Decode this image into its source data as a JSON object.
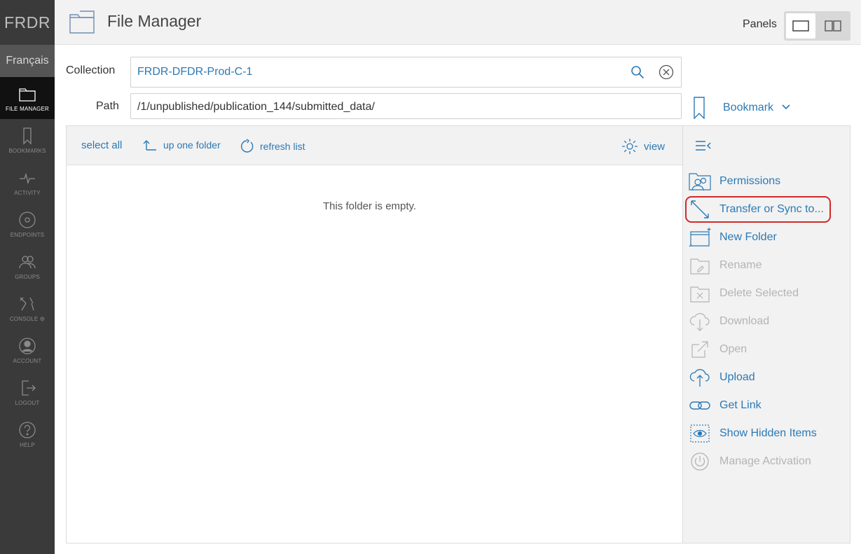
{
  "brand": "FRDR",
  "language": "Français",
  "nav": [
    {
      "label": "FILE MANAGER",
      "icon": "folder-icon",
      "active": true
    },
    {
      "label": "BOOKMARKS",
      "icon": "bookmark-icon",
      "active": false
    },
    {
      "label": "ACTIVITY",
      "icon": "activity-icon",
      "active": false
    },
    {
      "label": "ENDPOINTS",
      "icon": "endpoints-icon",
      "active": false
    },
    {
      "label": "GROUPS",
      "icon": "groups-icon",
      "active": false
    },
    {
      "label": "CONSOLE ⚙",
      "icon": "console-icon",
      "active": false
    },
    {
      "label": "ACCOUNT",
      "icon": "account-icon",
      "active": false
    },
    {
      "label": "LOGOUT",
      "icon": "logout-icon",
      "active": false
    },
    {
      "label": "HELP",
      "icon": "help-icon",
      "active": false
    }
  ],
  "header": {
    "title": "File Manager",
    "panels_label": "Panels"
  },
  "collection": {
    "label": "Collection",
    "value": "FRDR-DFDR-Prod-C-1"
  },
  "path": {
    "label": "Path",
    "value": "/1/unpublished/publication_144/submitted_data/"
  },
  "bookmark": {
    "label": "Bookmark"
  },
  "toolbar": {
    "select_all": "select all",
    "up_one_folder": "up one folder",
    "refresh_list": "refresh list",
    "view": "view"
  },
  "empty_message": "This folder is empty.",
  "commands": [
    {
      "label": "Permissions",
      "icon": "permissions-icon",
      "enabled": true
    },
    {
      "label": "Transfer or Sync to...",
      "icon": "transfer-icon",
      "enabled": true,
      "highlighted": true
    },
    {
      "label": "New Folder",
      "icon": "new-folder-icon",
      "enabled": true
    },
    {
      "label": "Rename",
      "icon": "rename-icon",
      "enabled": false
    },
    {
      "label": "Delete Selected",
      "icon": "delete-icon",
      "enabled": false
    },
    {
      "label": "Download",
      "icon": "download-icon",
      "enabled": false
    },
    {
      "label": "Open",
      "icon": "open-icon",
      "enabled": false
    },
    {
      "label": "Upload",
      "icon": "upload-icon",
      "enabled": true
    },
    {
      "label": "Get Link",
      "icon": "link-icon",
      "enabled": true
    },
    {
      "label": "Show Hidden Items",
      "icon": "eye-icon",
      "enabled": true
    },
    {
      "label": "Manage Activation",
      "icon": "power-icon",
      "enabled": false
    }
  ],
  "colors": {
    "accent": "#2b79b5",
    "sidebar": "#3a3a3a",
    "highlight": "#d12a2a",
    "disabled": "#b4b4b4"
  }
}
